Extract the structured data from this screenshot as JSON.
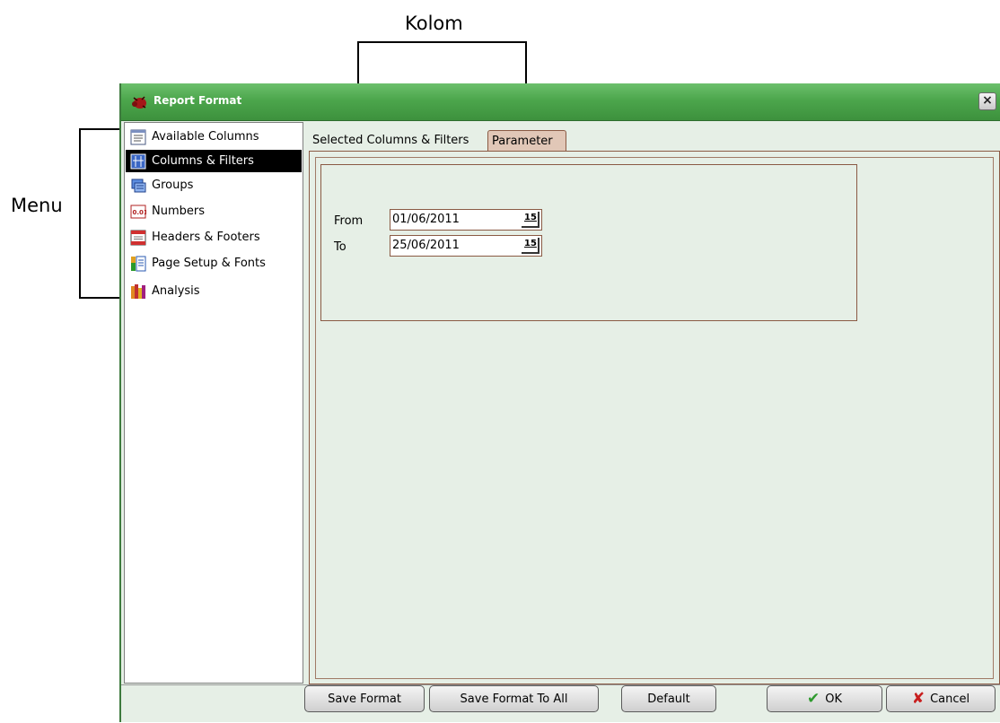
{
  "annotations": {
    "kolom_label": "Kolom",
    "menu_label": "Menu"
  },
  "window": {
    "title": "Report Format",
    "close_label": "×"
  },
  "sidebar": {
    "items": [
      {
        "label": "Available Columns",
        "icon": "list-icon"
      },
      {
        "label": "Columns & Filters",
        "icon": "columns-filter-icon",
        "selected": true
      },
      {
        "label": "Groups",
        "icon": "groups-icon"
      },
      {
        "label": "Numbers",
        "icon": "numbers-icon"
      },
      {
        "label": "Headers & Footers",
        "icon": "headers-footers-icon"
      },
      {
        "label": "Page Setup & Fonts",
        "icon": "page-setup-icon"
      },
      {
        "label": "Analysis",
        "icon": "analysis-icon"
      }
    ]
  },
  "tabs": [
    {
      "label": "Selected Columns & Filters",
      "active": false
    },
    {
      "label": "Parameter",
      "active": true
    }
  ],
  "parameters": {
    "from_label": "From",
    "from_value": "01/06/2011",
    "to_label": "To",
    "to_value": "25/06/2011",
    "calendar_label": "15"
  },
  "buttons": {
    "save_format": "Save Format",
    "save_format_to_all": "Save Format To All",
    "default": "Default",
    "ok": "OK",
    "cancel": "Cancel"
  },
  "colors": {
    "titlebar": "#4ca64c",
    "window_bg": "#e6efe6",
    "active_tab": "#e1c7b7",
    "ok_check": "#2e9a2e",
    "cancel_x": "#c81e1e"
  }
}
